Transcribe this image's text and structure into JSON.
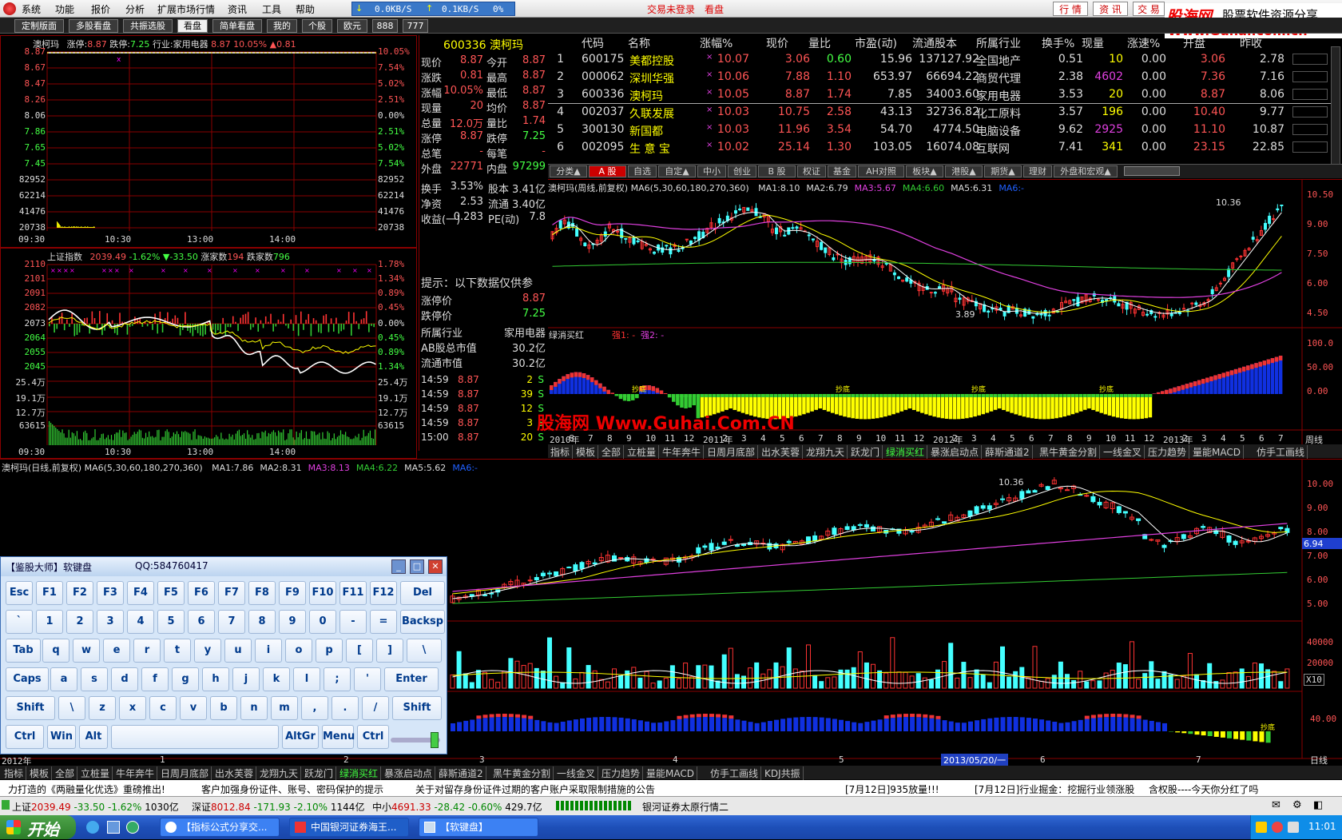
{
  "menubar": {
    "items": [
      "系统",
      "功能",
      "报价",
      "分析",
      "扩展市场行情",
      "资讯",
      "工具",
      "帮助"
    ],
    "net_down": "0.0KB/S",
    "net_up": "0.1KB/S",
    "net_pct": "0%",
    "login_status": "交易未登录",
    "view_mode": "看盘",
    "buttons": [
      "行 情",
      "资 讯",
      "交 易"
    ]
  },
  "logo": {
    "brand": "股海网",
    "slogan": "股票软件资源分享",
    "url": "Www.Guhai.com.cn"
  },
  "tabs": [
    "定制版面",
    "多股看盘",
    "共振选股",
    "看盘",
    "简单看盘",
    "我的",
    "个股",
    "欧元",
    "888",
    "777"
  ],
  "active_tab": "看盘",
  "intraday": {
    "header": {
      "name": "澳柯玛",
      "up_limit_label": "涨停:",
      "up_limit": "8.87",
      "down_limit_label": "跌停:",
      "down_limit": "7.25",
      "industry": "行业:家用电器",
      "price": "8.87",
      "pct": "10.05%",
      "change": "▲0.81"
    },
    "price_labels_left": [
      "8.87",
      "8.67",
      "8.47",
      "8.26",
      "8.06",
      "7.86",
      "7.65",
      "7.45"
    ],
    "pct_labels_right": [
      "10.05%",
      "7.54%",
      "5.02%",
      "2.51%",
      "0.00%",
      "2.51%",
      "5.02%",
      "7.54%"
    ],
    "vol_labels": [
      "82952",
      "62214",
      "41476",
      "20738"
    ],
    "time_labels": [
      "09:30",
      "10:30",
      "13:00",
      "14:00"
    ]
  },
  "index_panel": {
    "header": {
      "name": "上证指数",
      "value": "2039.49",
      "pct": "-1.62%",
      "change": "▼-33.50",
      "up_label": "涨家数",
      "up": "194",
      "down_label": "跌家数",
      "down": "796"
    },
    "labels_left": [
      "2110",
      "2101",
      "2091",
      "2082",
      "2073",
      "2064",
      "2055",
      "2045",
      "25.4万",
      "19.1万",
      "12.7万",
      "63615"
    ],
    "labels_right": [
      "1.78%",
      "1.34%",
      "0.89%",
      "0.45%",
      "0.00%",
      "0.45%",
      "0.89%",
      "1.34%",
      "25.4万",
      "19.1万",
      "12.7万",
      "63615"
    ],
    "time_labels": [
      "09:30",
      "10:30",
      "13:00",
      "14:00"
    ]
  },
  "quote": {
    "code": "600336",
    "name": "澳柯玛",
    "rows": [
      [
        "现价",
        "8.87",
        "今开",
        "8.87"
      ],
      [
        "涨跌",
        "0.81",
        "最高",
        "8.87"
      ],
      [
        "涨幅",
        "10.05%",
        "最低",
        "8.87"
      ],
      [
        "现量",
        "20",
        "均价",
        "8.87"
      ],
      [
        "总量",
        "12.0万",
        "量比",
        "1.74"
      ],
      [
        "涨停",
        "8.87",
        "跌停",
        "7.25"
      ],
      [
        "总笔",
        "-",
        "每笔",
        "-"
      ],
      [
        "外盘",
        "22771",
        "内盘",
        "97299"
      ]
    ],
    "fin_rows": [
      [
        "换手",
        "3.53%",
        "股本",
        "3.41亿"
      ],
      [
        "净资",
        "2.53",
        "流通",
        "3.40亿"
      ],
      [
        "收益(一)",
        "0.283",
        "PE(动)",
        "7.8"
      ]
    ],
    "tip": "提示：以下数据仅供参",
    "limit_rows": [
      [
        "涨停价",
        "8.87"
      ],
      [
        "跌停价",
        "7.25"
      ]
    ],
    "industry_rows": [
      [
        "所属行业",
        "家用电器"
      ],
      [
        "AB股总市值",
        "30.2亿"
      ],
      [
        "流通市值",
        "30.2亿"
      ]
    ],
    "ticks": [
      [
        "14:59",
        "8.87",
        "2",
        "S"
      ],
      [
        "14:59",
        "8.87",
        "39",
        "S"
      ],
      [
        "14:59",
        "8.87",
        "12",
        "S"
      ],
      [
        "14:59",
        "8.87",
        "3",
        "S"
      ],
      [
        "15:00",
        "8.87",
        "20",
        "S"
      ]
    ]
  },
  "table": {
    "headers": [
      "代码",
      "名称",
      "涨幅%",
      "现价",
      "量比",
      "市盈(动)",
      "流通股本",
      "所属行业",
      "换手%",
      "现量",
      "涨速%",
      "开盘",
      "昨收"
    ],
    "rows": [
      [
        "1",
        "600175",
        "美都控股",
        "10.07",
        "3.06",
        "0.60",
        "15.96",
        "137127.92",
        "全国地产",
        "0.51",
        "10",
        "0.00",
        "3.06",
        "2.78"
      ],
      [
        "2",
        "000062",
        "深圳华强",
        "10.06",
        "7.88",
        "1.10",
        "653.97",
        "66694.22",
        "商贸代理",
        "2.38",
        "4602",
        "0.00",
        "7.36",
        "7.16"
      ],
      [
        "3",
        "600336",
        "澳柯玛",
        "10.05",
        "8.87",
        "1.74",
        "7.85",
        "34003.60",
        "家用电器",
        "3.53",
        "20",
        "0.00",
        "8.87",
        "8.06"
      ],
      [
        "4",
        "002037",
        "久联发展",
        "10.03",
        "10.75",
        "2.58",
        "43.13",
        "32736.82",
        "化工原料",
        "3.57",
        "196",
        "0.00",
        "10.40",
        "9.77"
      ],
      [
        "5",
        "300130",
        "新国都",
        "10.03",
        "11.96",
        "3.54",
        "54.70",
        "4774.50",
        "电脑设备",
        "9.62",
        "2925",
        "0.00",
        "11.10",
        "10.87"
      ],
      [
        "6",
        "002095",
        "生 意 宝",
        "10.02",
        "25.14",
        "1.30",
        "103.05",
        "16074.08",
        "互联网",
        "7.41",
        "341",
        "0.00",
        "23.15",
        "22.85"
      ]
    ]
  },
  "category_tabs": [
    "分类▲",
    "A 股",
    "自选",
    "自定▲",
    "中小",
    "创业",
    "B 股",
    "权证",
    "基金",
    "AH对照",
    "板块▲",
    "港股▲",
    "期货▲",
    "理财",
    "外盘和宏观▲"
  ],
  "weekly_chart": {
    "header": "澳柯玛(周线,前复权) MA6(5,30,60,180,270,360)",
    "ma": [
      [
        "MA1:",
        "8.10"
      ],
      [
        "MA2:",
        "6.79"
      ],
      [
        "MA3:",
        "5.67"
      ],
      [
        "MA4:",
        "6.60"
      ],
      [
        "MA5:",
        "6.31"
      ],
      [
        "MA6:",
        "-"
      ]
    ],
    "price_labels": [
      "10.50",
      "9.00",
      "7.50",
      "6.00",
      "4.50"
    ],
    "high_label": "10.36",
    "low_label": "3.89",
    "indicator_header": "绿消买红",
    "strength1": "强1: -",
    "strength2": "强2: -",
    "ind_labels": [
      "100.0",
      "50.00",
      "0.00"
    ],
    "bottom_marker": "抄底",
    "time_axis": [
      "2010年",
      "6",
      "7",
      "8",
      "9",
      "10",
      "11",
      "12",
      "2011年",
      "2",
      "3",
      "4",
      "5",
      "6",
      "7",
      "8",
      "9",
      "10",
      "11",
      "12",
      "2012年",
      "2",
      "3",
      "4",
      "5",
      "6",
      "7",
      "8",
      "9",
      "10",
      "11",
      "12",
      "2013年",
      "2",
      "3",
      "4",
      "5",
      "6",
      "7"
    ],
    "period": "周线"
  },
  "watermark": "股海网 Www.Guhai.Com.CN",
  "ind_tabs": [
    "指标",
    "模板",
    "全部",
    "立桩量",
    "牛年奔牛",
    "日周月底部",
    "出水芙蓉",
    "龙翔九天",
    "跃龙门",
    "绿消买红",
    "暴涨启动点",
    "薛斯通道2",
    "黑牛黄金分割",
    "一线金叉",
    "压力趋势",
    "量能MACD",
    "仿手工画线"
  ],
  "ind_tabs_bottom": [
    "指标",
    "模板",
    "全部",
    "立桩量",
    "牛年奔牛",
    "日周月底部",
    "出水芙蓉",
    "龙翔九天",
    "跃龙门",
    "绿消买红",
    "暴涨启动点",
    "薛斯通道2",
    "黑牛黄金分割",
    "一线金叉",
    "压力趋势",
    "量能MACD",
    "仿手工画线",
    "KDJ共振"
  ],
  "daily_chart": {
    "header": "澳柯玛(日线,前复权) MA6(5,30,60,180,270,360)",
    "ma": [
      [
        "MA1:",
        "7.86"
      ],
      [
        "MA2:",
        "8.31"
      ],
      [
        "MA3:",
        "8.13"
      ],
      [
        "MA4:",
        "6.22"
      ],
      [
        "MA5:",
        "5.62"
      ],
      [
        "MA6:",
        "-"
      ]
    ],
    "price_labels": [
      "10.00",
      "9.00",
      "8.00",
      "7.00",
      "6.00",
      "5.00"
    ],
    "current_price_tag": "6.94",
    "high_label": "10.36",
    "vol_labels": [
      "40000",
      "20000"
    ],
    "vol_unit": "X10",
    "ind_label": "40.00",
    "bottom_marker": "抄底",
    "time_axis": [
      "2012年",
      "1",
      "2",
      "3",
      "4",
      "5",
      "6",
      "7"
    ],
    "cursor_date": "2013/05/20/一",
    "period": "日线"
  },
  "keyboard": {
    "title": "【鉴股大师】软键盘",
    "qq": "QQ:584760417",
    "rows": [
      [
        "Esc",
        "F1",
        "F2",
        "F3",
        "F4",
        "F5",
        "F6",
        "F7",
        "F8",
        "F9",
        "F10",
        "F11",
        "F12",
        "Del"
      ],
      [
        "`",
        "1",
        "2",
        "3",
        "4",
        "5",
        "6",
        "7",
        "8",
        "9",
        "0",
        "-",
        "=",
        "Backsp"
      ],
      [
        "Tab",
        "q",
        "w",
        "e",
        "r",
        "t",
        "y",
        "u",
        "i",
        "o",
        "p",
        "[",
        "]",
        "\\"
      ],
      [
        "Caps",
        "a",
        "s",
        "d",
        "f",
        "g",
        "h",
        "j",
        "k",
        "l",
        ";",
        "'",
        "Enter"
      ],
      [
        "Shift",
        "\\",
        "z",
        "x",
        "c",
        "v",
        "b",
        "n",
        "m",
        ",",
        ".",
        "/",
        "Shift"
      ],
      [
        "Ctrl",
        "Win",
        "Alt",
        "AltGr",
        "Menu",
        "Ctrl"
      ]
    ]
  },
  "news": [
    "力打造的《两融量化优选》重磅推出!",
    "客户加强身份证件、账号、密码保护的提示",
    "关于对留存身份证件过期的客户账户采取限制措施的公告",
    "[7月12日]935放量!!!",
    "[7月12日]行业掘金：挖掘行业领涨股",
    "含权股----今天你分红了吗"
  ],
  "status": {
    "sh": [
      "上证",
      "2039.49",
      "-33.50",
      "-1.62%",
      "1030亿"
    ],
    "sz": [
      "深证",
      "8012.84",
      "-171.93",
      "-2.10%",
      "1144亿"
    ],
    "zx": [
      "中小",
      "4691.33",
      "-28.42",
      "-0.60%",
      "429.7亿"
    ],
    "broker": "银河证券太原行情二"
  },
  "taskbar": {
    "start": "开始",
    "windows": [
      "【指标公式分享交...",
      "中国银河证券海王...",
      "【软键盘】"
    ],
    "clock": "11:01"
  }
}
